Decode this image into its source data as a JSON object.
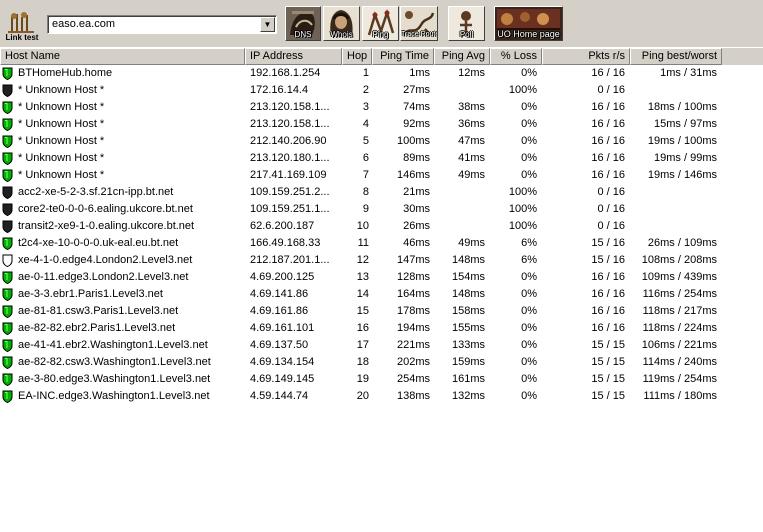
{
  "toolbar": {
    "link_test_label": "Link test",
    "address_value": "easo.ea.com",
    "buttons": [
      {
        "label": "DNS"
      },
      {
        "label": "Whois"
      },
      {
        "label": "Ping"
      },
      {
        "label": "Trace Route"
      },
      {
        "label": "Poll"
      },
      {
        "label": "UO Home page"
      }
    ]
  },
  "columns": [
    "Host Name",
    "IP Address",
    "Hop",
    "Ping Time",
    "Ping Avg",
    "% Loss",
    "Pkts r/s",
    "Ping best/worst"
  ],
  "colors": {
    "green_shield": "#00b000",
    "dark_shield": "#202020",
    "white_shield": "#ffffff"
  },
  "rows": [
    {
      "icon": "green",
      "host": "BTHomeHub.home",
      "ip": "192.168.1.254",
      "hop": "1",
      "time": "1ms",
      "avg": "12ms",
      "loss": "0%",
      "pkts": "16 / 16",
      "bw": "1ms / 31ms"
    },
    {
      "icon": "dark",
      "host": "* Unknown Host *",
      "ip": "172.16.14.4",
      "hop": "2",
      "time": "27ms",
      "avg": "",
      "loss": "100%",
      "pkts": "0 / 16",
      "bw": ""
    },
    {
      "icon": "green",
      "host": "* Unknown Host *",
      "ip": "213.120.158.1...",
      "hop": "3",
      "time": "74ms",
      "avg": "38ms",
      "loss": "0%",
      "pkts": "16 / 16",
      "bw": "18ms / 100ms"
    },
    {
      "icon": "green",
      "host": "* Unknown Host *",
      "ip": "213.120.158.1...",
      "hop": "4",
      "time": "92ms",
      "avg": "36ms",
      "loss": "0%",
      "pkts": "16 / 16",
      "bw": "15ms / 97ms"
    },
    {
      "icon": "green",
      "host": "* Unknown Host *",
      "ip": "212.140.206.90",
      "hop": "5",
      "time": "100ms",
      "avg": "47ms",
      "loss": "0%",
      "pkts": "16 / 16",
      "bw": "19ms / 100ms"
    },
    {
      "icon": "green",
      "host": "* Unknown Host *",
      "ip": "213.120.180.1...",
      "hop": "6",
      "time": "89ms",
      "avg": "41ms",
      "loss": "0%",
      "pkts": "16 / 16",
      "bw": "19ms / 99ms"
    },
    {
      "icon": "green",
      "host": "* Unknown Host *",
      "ip": "217.41.169.109",
      "hop": "7",
      "time": "146ms",
      "avg": "49ms",
      "loss": "0%",
      "pkts": "16 / 16",
      "bw": "19ms / 146ms"
    },
    {
      "icon": "dark",
      "host": "acc2-xe-5-2-3.sf.21cn-ipp.bt.net",
      "ip": "109.159.251.2...",
      "hop": "8",
      "time": "21ms",
      "avg": "",
      "loss": "100%",
      "pkts": "0 / 16",
      "bw": ""
    },
    {
      "icon": "dark",
      "host": "core2-te0-0-0-6.ealing.ukcore.bt.net",
      "ip": "109.159.251.1...",
      "hop": "9",
      "time": "30ms",
      "avg": "",
      "loss": "100%",
      "pkts": "0 / 16",
      "bw": ""
    },
    {
      "icon": "dark",
      "host": "transit2-xe9-1-0.ealing.ukcore.bt.net",
      "ip": "62.6.200.187",
      "hop": "10",
      "time": "26ms",
      "avg": "",
      "loss": "100%",
      "pkts": "0 / 16",
      "bw": ""
    },
    {
      "icon": "green",
      "host": "t2c4-xe-10-0-0-0.uk-eal.eu.bt.net",
      "ip": "166.49.168.33",
      "hop": "11",
      "time": "46ms",
      "avg": "49ms",
      "loss": "6%",
      "pkts": "15 / 16",
      "bw": "26ms / 109ms"
    },
    {
      "icon": "white",
      "host": "xe-4-1-0.edge4.London2.Level3.net",
      "ip": "212.187.201.1...",
      "hop": "12",
      "time": "147ms",
      "avg": "148ms",
      "loss": "6%",
      "pkts": "15 / 16",
      "bw": "108ms / 208ms"
    },
    {
      "icon": "green",
      "host": "ae-0-11.edge3.London2.Level3.net",
      "ip": "4.69.200.125",
      "hop": "13",
      "time": "128ms",
      "avg": "154ms",
      "loss": "0%",
      "pkts": "16 / 16",
      "bw": "109ms / 439ms"
    },
    {
      "icon": "green",
      "host": "ae-3-3.ebr1.Paris1.Level3.net",
      "ip": "4.69.141.86",
      "hop": "14",
      "time": "164ms",
      "avg": "148ms",
      "loss": "0%",
      "pkts": "16 / 16",
      "bw": "116ms / 254ms"
    },
    {
      "icon": "green",
      "host": "ae-81-81.csw3.Paris1.Level3.net",
      "ip": "4.69.161.86",
      "hop": "15",
      "time": "178ms",
      "avg": "158ms",
      "loss": "0%",
      "pkts": "16 / 16",
      "bw": "118ms / 217ms"
    },
    {
      "icon": "green",
      "host": "ae-82-82.ebr2.Paris1.Level3.net",
      "ip": "4.69.161.101",
      "hop": "16",
      "time": "194ms",
      "avg": "155ms",
      "loss": "0%",
      "pkts": "16 / 16",
      "bw": "118ms / 224ms"
    },
    {
      "icon": "green",
      "host": "ae-41-41.ebr2.Washington1.Level3.net",
      "ip": "4.69.137.50",
      "hop": "17",
      "time": "221ms",
      "avg": "133ms",
      "loss": "0%",
      "pkts": "15 / 15",
      "bw": "106ms / 221ms"
    },
    {
      "icon": "green",
      "host": "ae-82-82.csw3.Washington1.Level3.net",
      "ip": "4.69.134.154",
      "hop": "18",
      "time": "202ms",
      "avg": "159ms",
      "loss": "0%",
      "pkts": "15 / 15",
      "bw": "114ms / 240ms"
    },
    {
      "icon": "green",
      "host": "ae-3-80.edge3.Washington1.Level3.net",
      "ip": "4.69.149.145",
      "hop": "19",
      "time": "254ms",
      "avg": "161ms",
      "loss": "0%",
      "pkts": "15 / 15",
      "bw": "119ms / 254ms"
    },
    {
      "icon": "green",
      "host": "EA-INC.edge3.Washington1.Level3.net",
      "ip": "4.59.144.74",
      "hop": "20",
      "time": "138ms",
      "avg": "132ms",
      "loss": "0%",
      "pkts": "15 / 15",
      "bw": "111ms / 180ms"
    }
  ]
}
